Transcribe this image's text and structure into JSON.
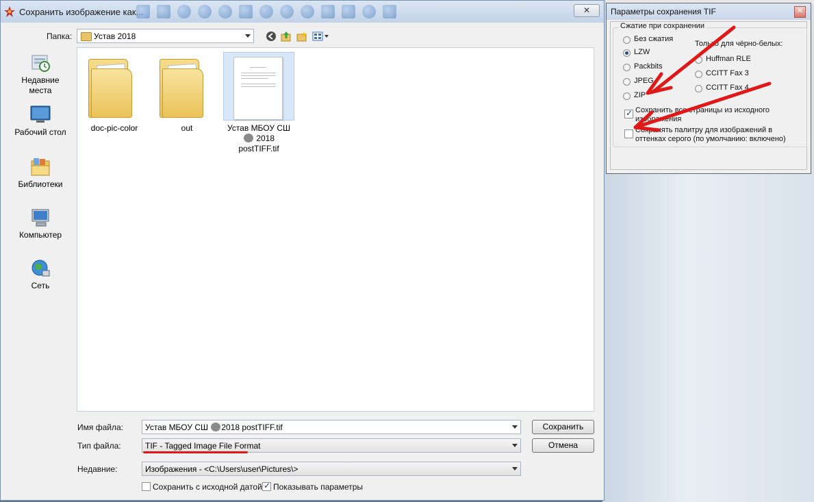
{
  "save_dialog": {
    "title": "Сохранить изображение как...",
    "folder_label": "Папка:",
    "folder_value": "Устав 2018",
    "places": [
      {
        "label": "Недавние места",
        "icon": "recent-places-icon"
      },
      {
        "label": "Рабочий стол",
        "icon": "desktop-icon"
      },
      {
        "label": "Библиотеки",
        "icon": "libraries-icon"
      },
      {
        "label": "Компьютер",
        "icon": "computer-icon"
      },
      {
        "label": "Сеть",
        "icon": "network-icon"
      }
    ],
    "files": [
      {
        "name": "doc-pic-color",
        "type": "folder"
      },
      {
        "name": "out",
        "type": "folder"
      },
      {
        "name_part1": "Устав МБОУ СШ",
        "name_part2": "2018 postTIFF.tif",
        "type": "document"
      }
    ],
    "filename_label": "Имя файла:",
    "filename_part1": "Устав МБОУ СШ",
    "filename_part2": "2018 postTIFF.tif",
    "filetype_label": "Тип файла:",
    "filetype_value": "TIF - Tagged Image File Format",
    "recent_label": "Недавние:",
    "recent_value": "Изображения  -  <C:\\Users\\user\\Pictures\\>",
    "save_button": "Сохранить",
    "cancel_button": "Отмена",
    "keep_date_label": "Сохранить с исходной датой",
    "keep_date_checked": false,
    "show_params_label": "Показывать параметры",
    "show_params_checked": true
  },
  "tif_dialog": {
    "title": "Параметры сохранения TIF",
    "compression_group": "Сжатие при сохранении",
    "compression_options": [
      "Без сжатия",
      "LZW",
      "Packbits",
      "JPEG",
      "ZIP"
    ],
    "selected_compression": "LZW",
    "bw_only_label": "Только для чёрно-белых:",
    "bw_options": [
      "Huffman RLE",
      "CCITT Fax 3",
      "CCITT Fax 4"
    ],
    "save_all_pages_line1": "Сохранить все страницы из исходного",
    "save_all_pages_line2": "изображения",
    "save_all_pages_checked": true,
    "grayscale_palette_line1": "Сохранять палитру для изображений в",
    "grayscale_palette_line2": "оттенках серого (по умолчанию: включено)",
    "grayscale_palette_checked": false
  },
  "colors": {
    "annotation_red": "#e01818",
    "selection_blue": "#d9e8f8",
    "radio_dot": "#2a4d8a"
  }
}
